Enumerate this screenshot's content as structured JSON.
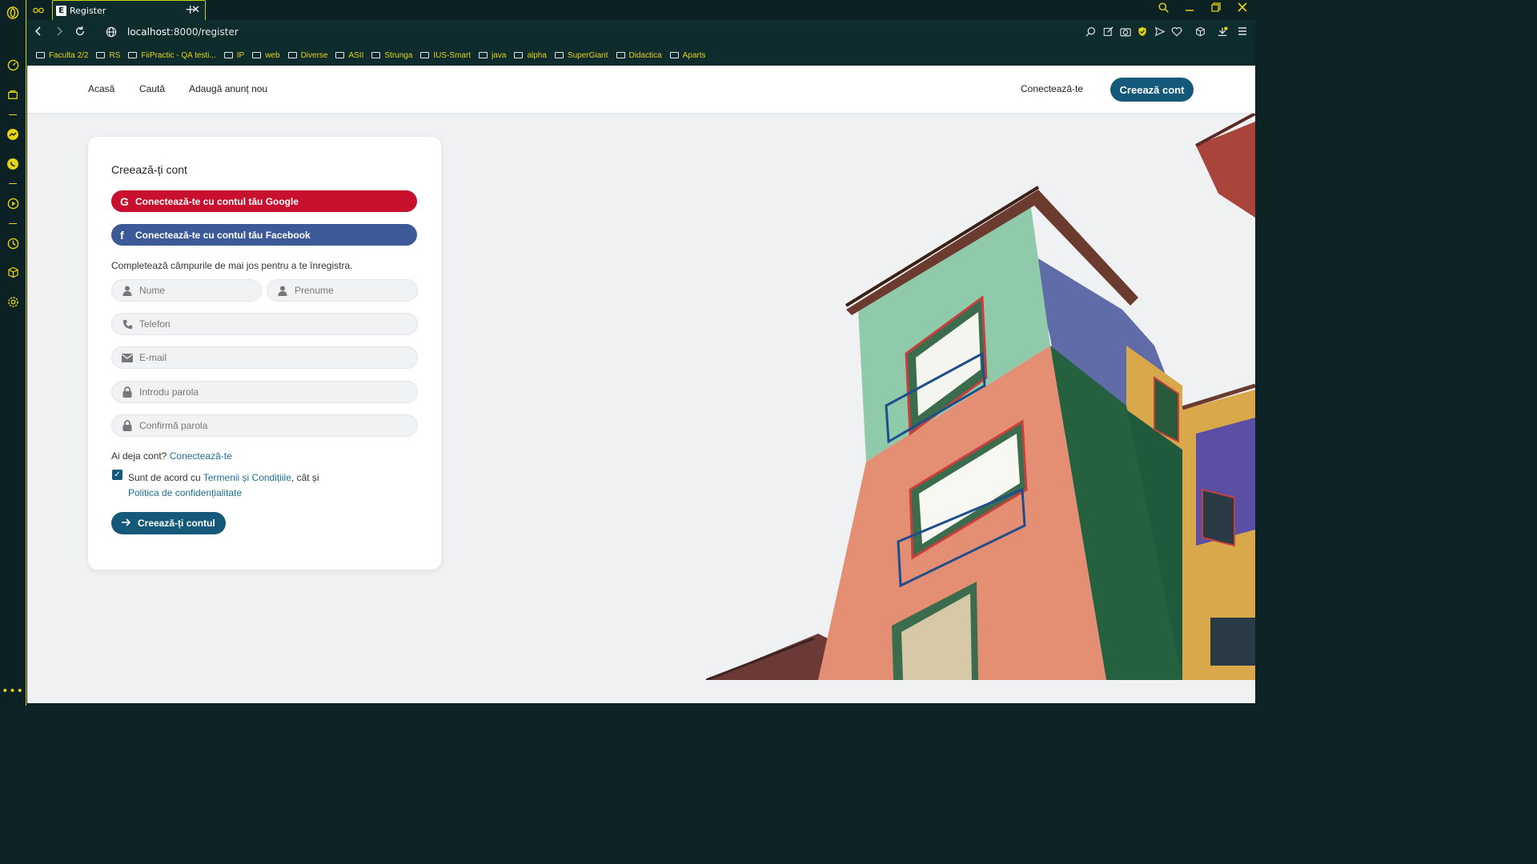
{
  "browser": {
    "tab_title": "Register",
    "tab_favicon": "E",
    "url_host": "localhost",
    "url_path": ":8000/register",
    "bookmarks": [
      "Faculta 2/2",
      "RS",
      "FiiPractic - QA testi...",
      "IP",
      "web",
      "Diverse",
      "ASII",
      "Strunga",
      "IUS-Smart",
      "java",
      "alpha",
      "SuperGiant",
      "Didactica",
      "Aparts"
    ],
    "icons": {
      "back": "back-arrow-icon",
      "forward": "forward-arrow-icon",
      "reload": "reload-icon",
      "site_info": "globe-icon",
      "search": "search-icon",
      "minimize": "minimize-icon",
      "restore": "restore-icon",
      "close": "close-icon"
    },
    "accent": "#e6d415"
  },
  "nav": {
    "home": "Acasă",
    "search": "Caută",
    "add_listing": "Adaugă anunț nou",
    "login": "Conectează-te",
    "create_account": "Creează cont"
  },
  "form": {
    "title": "Creează-ți cont",
    "google": "Conectează-te cu contul tău Google",
    "facebook": "Conectează-te cu contul tău Facebook",
    "hint": "Completează câmpurile de mai jos pentru a te înregistra.",
    "fields": {
      "last_name": "Nume",
      "first_name": "Prenume",
      "phone": "Telefon",
      "email": "E-mail",
      "password": "Introdu parola",
      "confirm_password": "Confirmă parola"
    },
    "already_text": "Ai deja cont?",
    "already_link": "Conectează-te",
    "terms_prefix": "Sunt de acord cu",
    "terms_link": "Termenii și Condițiile",
    "terms_middle": ", cât și",
    "privacy_link": "Politica de confidențialitate",
    "terms_checked": true,
    "submit": "Creează-ți contul"
  },
  "colors": {
    "primary": "#15597a",
    "google": "#c8102e",
    "facebook": "#3d5a98",
    "link": "#1d6f93"
  }
}
